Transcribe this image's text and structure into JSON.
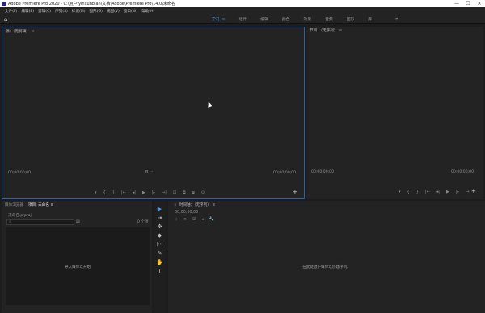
{
  "titlebar": {
    "title": "Adobe Premiere Pro 2020 - C:\\用户\\yinxunbian\\文档\\Adobe\\Premiere Pro\\14.0\\未命名",
    "minimize": "—",
    "maximize": "☐",
    "close": "✕"
  },
  "menu": [
    "文件(F)",
    "编辑(E)",
    "剪辑(C)",
    "序列(S)",
    "标记(M)",
    "图形(G)",
    "视图(V)",
    "窗口(W)",
    "帮助(H)"
  ],
  "workspaces": {
    "home": "⌂",
    "tabs": [
      "学习",
      "组件",
      "编辑",
      "颜色",
      "效果",
      "音频",
      "图形",
      "库"
    ],
    "active_index": 0,
    "more": "»"
  },
  "source_monitor": {
    "title": "源：（无剪辑）",
    "menu": "≡",
    "tc_left": "00;00;00;00",
    "tc_right": "00;00;00;00",
    "mid_controls": "▥ ⋯",
    "controls": [
      "▾",
      "{",
      "}",
      "|←",
      "◂|",
      "▶",
      "|▸",
      "→|",
      "⊡",
      "⧉",
      "⧈",
      "⊙"
    ],
    "add": "+"
  },
  "program_monitor": {
    "title": "节目：（无序列）",
    "menu": "≡",
    "tc_left": "00;00;00;00",
    "tc_right": "00;00;00;00",
    "controls": [
      "▾",
      "{",
      "}",
      "|←",
      "◂|",
      "▶",
      "|▸",
      "→|"
    ],
    "add": "+"
  },
  "project": {
    "tabs": [
      "媒体浏览器",
      "项目: 未命名"
    ],
    "active_tab": 1,
    "tab_menu": "≡",
    "file": "未命名.prproj",
    "search_icon": "⌕",
    "bin_icon": "▤",
    "count": "0 个项",
    "drop_text": "导入媒体以开始"
  },
  "tools": [
    "▶",
    "⇥",
    "✥",
    "◆",
    "|↔|",
    "✎",
    "✋",
    "T"
  ],
  "timeline": {
    "close": "×",
    "title": "时间轴：（无序列）",
    "menu": "≡",
    "timecode": "00;00;00;00",
    "tools": [
      "⊹",
      "∩",
      "⊞",
      "◂",
      "🔧"
    ],
    "empty_text": "在此处放下媒体以创建序列。"
  }
}
